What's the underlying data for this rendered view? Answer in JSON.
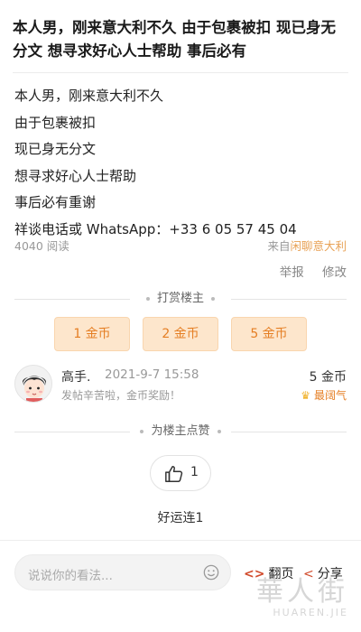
{
  "post": {
    "title": "本人男，刚来意大利不久 由于包裹被扣 现已身无分文 想寻求好心人士帮助 事后必有",
    "body_lines": [
      "本人男，刚来意大利不久",
      "由于包裹被扣",
      "现已身无分文",
      "想寻求好心人士帮助",
      "事后必有重谢",
      "祥谈电话或 WhatsApp：+33 6 05 57 45 04"
    ],
    "reads": "4040 阅读",
    "source_prefix": "来自",
    "source_forum": "闲聊意大利",
    "report_label": "举报",
    "edit_label": "修改"
  },
  "tip": {
    "section_label": "打赏楼主",
    "buttons": [
      "1 金币",
      "2 金币",
      "5 金币"
    ],
    "records": [
      {
        "name": "高手.",
        "time": "2021-9-7 15:58",
        "message": "发帖辛苦啦，金币奖励！",
        "amount": "5 金币",
        "badge": "最阔气"
      }
    ]
  },
  "like": {
    "section_label": "为楼主点赞",
    "count": "1",
    "likers": "好运连1"
  },
  "bottom_bar": {
    "comment_placeholder": "说说你的看法...",
    "flip_label": "翻页",
    "flip_icon": "<>",
    "share_label": "分享",
    "share_icon": "<"
  },
  "watermark": {
    "cn": "華人街",
    "en": "HUAREN.JIE"
  },
  "colors": {
    "accent": "#e57e23",
    "coin_bg": "#fde6cc",
    "icon_red": "#d14a2b"
  }
}
